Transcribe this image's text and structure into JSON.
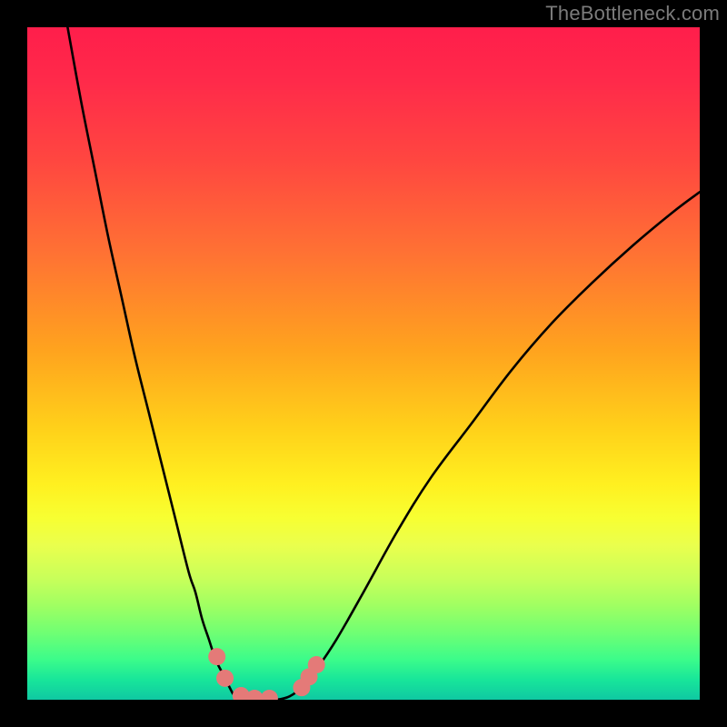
{
  "watermark": "TheBottleneck.com",
  "colors": {
    "frame": "#000000",
    "curve": "#000000",
    "marker_fill": "#e47a78",
    "marker_stroke": "#a94d4c",
    "gradient_top": "#ff1e4b",
    "gradient_mid": "#fff020",
    "gradient_bottom": "#0fc8a2"
  },
  "chart_data": {
    "type": "line",
    "title": "",
    "xlabel": "",
    "ylabel": "",
    "xlim": [
      0,
      100
    ],
    "ylim": [
      0,
      100
    ],
    "grid": false,
    "legend": false,
    "note": "Y is bottleneck percentage (0 at bottom / green, 100 at top / red). X is an unlabeled component-capability axis. Values are estimated from the plot.",
    "series": [
      {
        "name": "left-branch",
        "x": [
          6,
          8,
          10,
          12,
          14,
          16,
          18,
          20,
          22,
          24,
          25,
          26,
          27,
          28,
          29,
          30,
          31
        ],
        "y": [
          100,
          89,
          79,
          69,
          60,
          51,
          43,
          35,
          27,
          19,
          16,
          12,
          9,
          6,
          4,
          2,
          0.5
        ]
      },
      {
        "name": "valley-floor",
        "x": [
          31,
          33,
          35,
          37,
          39
        ],
        "y": [
          0.5,
          0,
          0,
          0,
          0.5
        ]
      },
      {
        "name": "right-branch",
        "x": [
          39,
          41,
          43,
          46,
          50,
          55,
          60,
          66,
          72,
          78,
          84,
          90,
          96,
          100
        ],
        "y": [
          0.5,
          2,
          4.5,
          9,
          16,
          25,
          33,
          41,
          49,
          56,
          62,
          67.5,
          72.5,
          75.5
        ]
      }
    ],
    "markers": {
      "name": "highlighted-points",
      "points": [
        {
          "x": 28.2,
          "y": 6.4
        },
        {
          "x": 29.4,
          "y": 3.2
        },
        {
          "x": 31.8,
          "y": 0.6
        },
        {
          "x": 33.8,
          "y": 0.2
        },
        {
          "x": 36.0,
          "y": 0.2
        },
        {
          "x": 40.8,
          "y": 1.8
        },
        {
          "x": 41.9,
          "y": 3.4
        },
        {
          "x": 43.0,
          "y": 5.2
        }
      ]
    }
  }
}
